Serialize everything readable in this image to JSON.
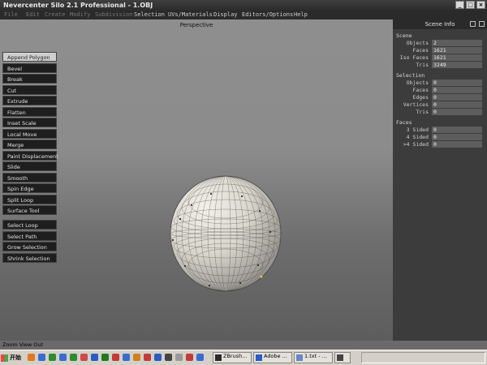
{
  "window": {
    "title": "Nevercenter Silo 2.1 Professional - 1.OBJ",
    "buttons": [
      "_",
      "□",
      "×"
    ]
  },
  "menu": {
    "items": [
      "File",
      "Edit",
      "Create",
      "Modify",
      "Subdivision",
      "Selection",
      "UVs/Materials",
      "Display",
      "Editors/Options",
      "Help"
    ]
  },
  "viewport": {
    "label": "Perspective"
  },
  "tools": {
    "header": "",
    "items": [
      "Append Polygon",
      "Bevel",
      "Break",
      "Cut",
      "Extrude",
      "Flatten",
      "Inset Scale",
      "Local Move",
      "Merge",
      "Paint Displacement",
      "Slide",
      "Smooth",
      "Spin Edge",
      "Split Loop",
      "Surface Tool"
    ],
    "select_items": [
      "Select Loop",
      "Select Path",
      "Grow Selection",
      "Shrink Selection"
    ]
  },
  "scene_info": {
    "title": "Scene Info",
    "scene_label": "Scene",
    "scene": [
      {
        "label": "Objects",
        "value": "2"
      },
      {
        "label": "Faces",
        "value": "1621"
      },
      {
        "label": "Iso Faces",
        "value": "1621"
      },
      {
        "label": "Tris",
        "value": "3249"
      }
    ],
    "selection_label": "Selection",
    "selection": [
      {
        "label": "Objects",
        "value": "0"
      },
      {
        "label": "Faces",
        "value": "0"
      },
      {
        "label": "Edges",
        "value": "0"
      },
      {
        "label": "Vertices",
        "value": "0"
      },
      {
        "label": "Tris",
        "value": "0"
      }
    ],
    "faces_label": "Faces",
    "faces": [
      {
        "label": "3 Sided",
        "value": "0"
      },
      {
        "label": "4 Sided",
        "value": "0"
      },
      {
        "label": ">4 Sided",
        "value": "0"
      }
    ]
  },
  "status": {
    "text": "Zoom View Out"
  },
  "taskbar": {
    "start_label": "开始",
    "tasks": [
      {
        "label": "ZBrush...",
        "icon_color": "#2a2a2a"
      },
      {
        "label": "Adobe ...",
        "icon_color": "#2a5cc4"
      },
      {
        "label": "1.txt - ...",
        "icon_color": "#6c86c6"
      },
      {
        "label": "",
        "icon_color": "#444444"
      }
    ]
  }
}
